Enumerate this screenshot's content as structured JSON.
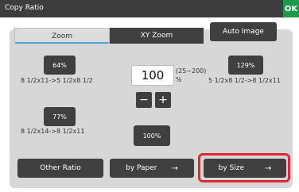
{
  "header": {
    "title": "Copy Ratio",
    "ok_label": "OK"
  },
  "tabs": [
    {
      "label": "Zoom",
      "active": true
    },
    {
      "label": "XY Zoom",
      "active": false
    }
  ],
  "auto_image_label": "Auto Image",
  "presets": {
    "p64": {
      "label": "64%",
      "desc": "8 1/2x11->5 1/2x8 1/2"
    },
    "p129": {
      "label": "129%",
      "desc": "5 1/2x8 1/2->8 1/2x11"
    },
    "p77": {
      "label": "77%",
      "desc": "8 1/2x14->8 1/2x11"
    },
    "p100": {
      "label": "100%"
    }
  },
  "ratio": {
    "value": "100",
    "range": "(25~200)",
    "unit": "%"
  },
  "steppers": {
    "minus": "−",
    "plus": "+"
  },
  "bottom": {
    "other_ratio": "Other Ratio",
    "by_paper": "by Paper",
    "by_size": "by Size",
    "arrow": "→"
  },
  "colors": {
    "highlight": "#e0283a",
    "ok": "#1e9a4a",
    "tab_underline": "#4aa5d8"
  }
}
